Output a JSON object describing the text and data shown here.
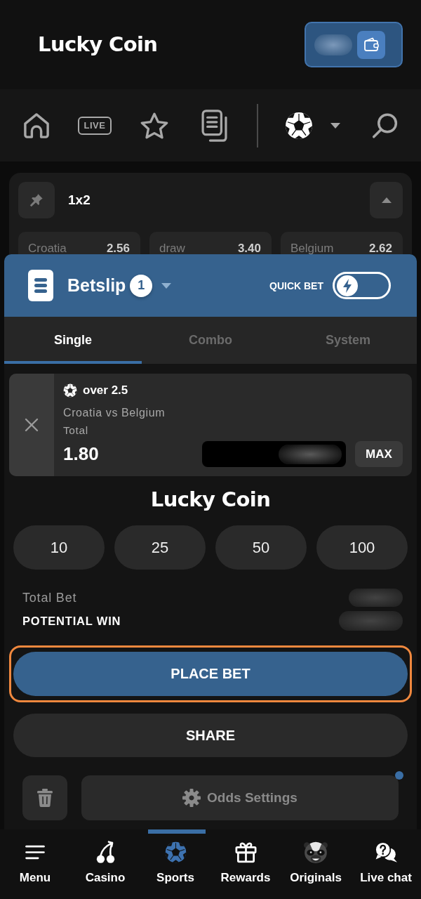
{
  "header": {
    "logo": "Lucky Coin"
  },
  "top_nav": {
    "live_label": "LIVE"
  },
  "market": {
    "title": "1x2",
    "expanded": true,
    "odds": [
      {
        "label": "Croatia",
        "value": "2.56"
      },
      {
        "label": "draw",
        "value": "3.40"
      },
      {
        "label": "Belgium",
        "value": "2.62"
      }
    ]
  },
  "betslip": {
    "title": "Betslip",
    "count": "1",
    "quick_bet": {
      "label": "QUICK BET",
      "on": false
    },
    "tabs": [
      {
        "label": "Single",
        "selected": true
      },
      {
        "label": "Combo",
        "selected": false
      },
      {
        "label": "System",
        "selected": false
      }
    ],
    "selections": [
      {
        "market": "over 2.5",
        "event": "Croatia vs Belgium",
        "bet_type": "Total",
        "odds": "1.80",
        "max_button": "MAX"
      }
    ],
    "logo": "Lucky Coin",
    "quick_stakes": [
      "10",
      "25",
      "50",
      "100"
    ],
    "summary": [
      {
        "label": "Total Bet",
        "kind": "plain"
      },
      {
        "label": "POTENTIAL WIN",
        "kind": "strong"
      }
    ],
    "place_bet": {
      "label": "PLACE BET",
      "focused": true
    },
    "share": "SHARE",
    "odds_settings": {
      "label": "Odds Settings",
      "notification": true
    }
  },
  "bottom_nav": [
    {
      "kind": "menu",
      "label": "Menu",
      "selected": false
    },
    {
      "kind": "casino",
      "label": "Casino",
      "selected": false
    },
    {
      "kind": "sports",
      "label": "Sports",
      "selected": true
    },
    {
      "kind": "rewards",
      "label": "Rewards",
      "selected": false
    },
    {
      "kind": "originals",
      "label": "Originals",
      "selected": false
    },
    {
      "kind": "chat",
      "label": "Live chat",
      "selected": false
    }
  ]
}
